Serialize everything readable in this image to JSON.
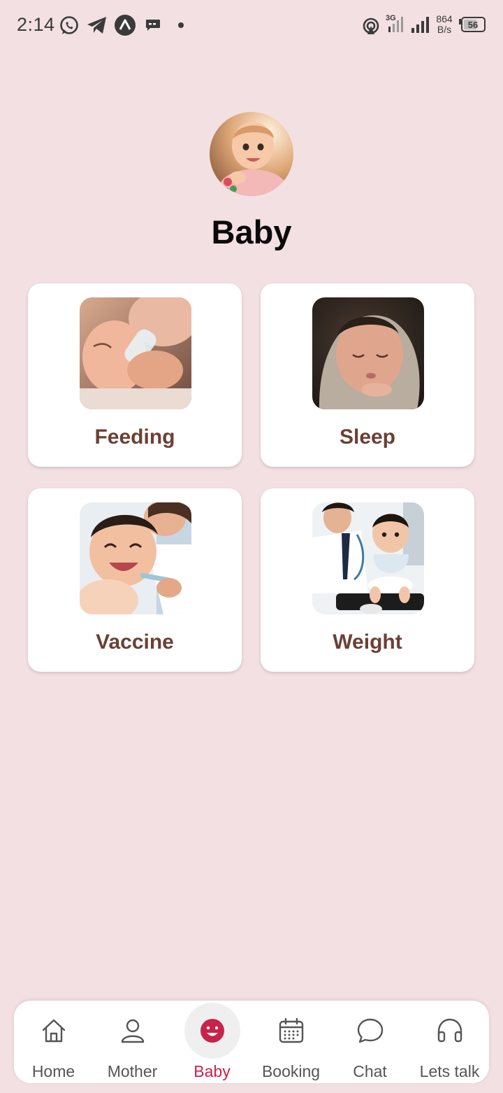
{
  "status_bar": {
    "time": "2:14",
    "network_speed_value": "864",
    "network_speed_unit": "B/s",
    "battery": "56",
    "network_type": "3G"
  },
  "header": {
    "title": "Baby"
  },
  "cards": [
    {
      "label": "Feeding"
    },
    {
      "label": "Sleep"
    },
    {
      "label": "Vaccine"
    },
    {
      "label": "Weight"
    }
  ],
  "bottom_nav": {
    "items": [
      {
        "label": "Home",
        "icon": "home-icon"
      },
      {
        "label": "Mother",
        "icon": "person-icon"
      },
      {
        "label": "Baby",
        "icon": "baby-face-icon",
        "active": true
      },
      {
        "label": "Booking",
        "icon": "calendar-icon"
      },
      {
        "label": "Chat",
        "icon": "chat-bubble-icon"
      },
      {
        "label": "Lets talk",
        "icon": "headphones-icon"
      }
    ],
    "active_color": "#c8234a"
  },
  "colors": {
    "background": "#f2e0e2",
    "card_label": "#6b4034",
    "accent": "#c8234a"
  }
}
